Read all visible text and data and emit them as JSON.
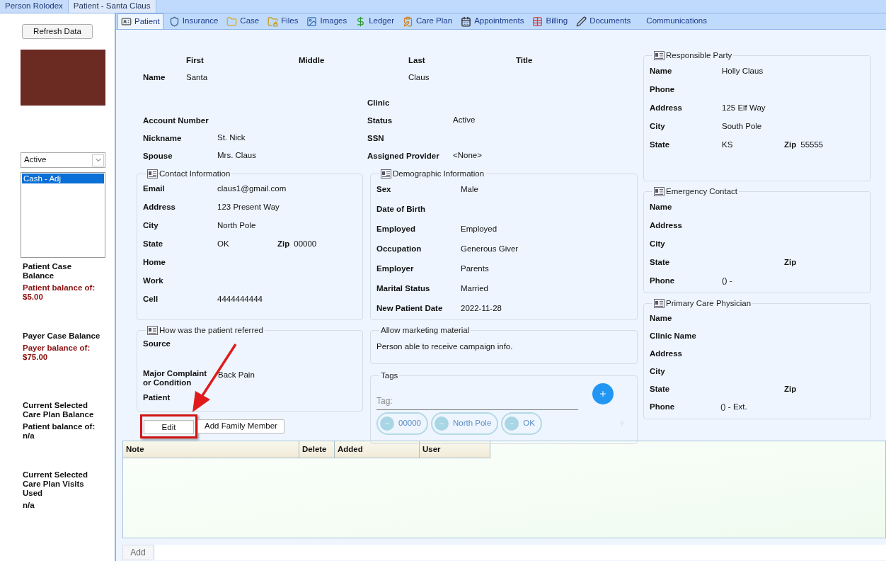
{
  "top_tabs": [
    {
      "label": "Person Rolodex",
      "selected": false
    },
    {
      "label": "Patient - Santa Claus",
      "selected": true
    }
  ],
  "sidebar": {
    "refresh_button": "Refresh Data",
    "status_select": {
      "value": "Active"
    },
    "case_list": [
      {
        "label": "Cash - Adj",
        "selected": true
      }
    ],
    "balances": [
      {
        "heading": "Patient Case Balance",
        "detail": "Patient balance of:",
        "amount": "$5.00",
        "kind": "alert"
      },
      {
        "heading": "Payer Case Balance",
        "detail": "Payer balance of:",
        "amount": "$75.00",
        "kind": "alert"
      },
      {
        "heading": "Current Selected Care Plan Balance",
        "detail": "Patient balance of:",
        "amount": "n/a",
        "kind": "plain"
      },
      {
        "heading": "Current Selected Care Plan Visits Used",
        "amount": "n/a",
        "kind": "plain"
      }
    ]
  },
  "module_tabs": [
    {
      "label": "Patient",
      "selected": true
    },
    {
      "label": "Insurance",
      "selected": false
    },
    {
      "label": "Case",
      "selected": false
    },
    {
      "label": "Files",
      "selected": false
    },
    {
      "label": "Images",
      "selected": false
    },
    {
      "label": "Ledger",
      "selected": false
    },
    {
      "label": "Care Plan",
      "selected": false
    },
    {
      "label": "Appointments",
      "selected": false
    },
    {
      "label": "Billing",
      "selected": false
    },
    {
      "label": "Documents",
      "selected": false
    },
    {
      "label": "Communications",
      "selected": false
    }
  ],
  "name_fields": {
    "label": "Name",
    "columns": [
      {
        "heading": "First",
        "value": "Santa"
      },
      {
        "heading": "Middle"
      },
      {
        "heading": "Last",
        "value": "Claus"
      },
      {
        "heading": "Title"
      }
    ]
  },
  "details_left": [
    {
      "label": "Account Number"
    },
    {
      "label": "Nickname",
      "value": "St. Nick"
    },
    {
      "label": "Spouse",
      "value": "Mrs. Claus"
    }
  ],
  "details_right": [
    {
      "label": "Clinic"
    },
    {
      "label": "Status",
      "value": "Active"
    },
    {
      "label": "SSN"
    },
    {
      "label": "Assigned Provider",
      "value": "<None>"
    }
  ],
  "contact": {
    "title": "Contact Information",
    "has_icon": true,
    "rows": [
      {
        "label": "Email",
        "value": "claus1@gmail.com"
      },
      {
        "label": "Address",
        "value": "123 Present Way"
      },
      {
        "label": "City",
        "value": "North Pole"
      },
      {
        "label": "State",
        "value": "OK",
        "extra_label": "Zip",
        "extra_value": "00000"
      },
      {
        "label": "Home"
      },
      {
        "label": "Work"
      },
      {
        "label": "Cell",
        "value": "4444444444"
      }
    ]
  },
  "demographics": {
    "title": "Demographic Information",
    "has_icon": true,
    "rows": [
      {
        "label": "Sex",
        "value": "Male"
      },
      {
        "label": "Date of Birth"
      },
      {
        "label": "Employed",
        "value": "Employed"
      },
      {
        "label": "Occupation",
        "value": "Generous Giver"
      },
      {
        "label": "Employer",
        "value": "Parents"
      },
      {
        "label": "Marital Status",
        "value": "Married"
      },
      {
        "label": "New Patient Date",
        "value": "2022-11-28"
      }
    ]
  },
  "referral": {
    "title": "How was the patient referred",
    "has_icon": true,
    "rows": [
      {
        "label": "Source"
      },
      {
        "label": "Major Complaint or Condition",
        "value": "Back Pain"
      },
      {
        "label": "Patient"
      }
    ]
  },
  "actions": [
    "Edit",
    "Add Family Member"
  ],
  "marketing": {
    "title": "Allow marketing material",
    "has_icon": false,
    "text": "Person able to receive campaign info."
  },
  "tags": {
    "title": "Tags",
    "has_icon": false,
    "placeholder": "Tag:",
    "items": [
      "00000",
      "North Pole",
      "OK"
    ]
  },
  "responsible_party": {
    "title": "Responsible Party",
    "has_icon": true,
    "rows": [
      {
        "label": "Name",
        "value": "Holly Claus"
      },
      {
        "label": "Phone"
      },
      {
        "label": "Address",
        "value": "125 Elf Way"
      },
      {
        "label": "City",
        "value": "South Pole"
      },
      {
        "label": "State",
        "value": "KS",
        "extra_label": "Zip",
        "extra_value": "55555"
      }
    ]
  },
  "emergency_contact": {
    "title": "Emergency Contact",
    "has_icon": true,
    "rows": [
      {
        "label": "Name"
      },
      {
        "label": "Address"
      },
      {
        "label": "City"
      },
      {
        "label": "State",
        "extra_label": "Zip"
      },
      {
        "label": "Phone",
        "value": "() -"
      }
    ]
  },
  "primary_care_physician": {
    "title": "Primary Care Physician",
    "has_icon": true,
    "rows": [
      {
        "label": "Name"
      },
      {
        "label": "Clinic Name"
      },
      {
        "label": "Address"
      },
      {
        "label": "City"
      },
      {
        "label": "State",
        "extra_label": "Zip"
      },
      {
        "label": "Phone",
        "value": "() - Ext."
      }
    ]
  },
  "notes": {
    "columns": [
      "Note",
      "Delete",
      "Added",
      "User"
    ]
  },
  "add_button": "Add"
}
